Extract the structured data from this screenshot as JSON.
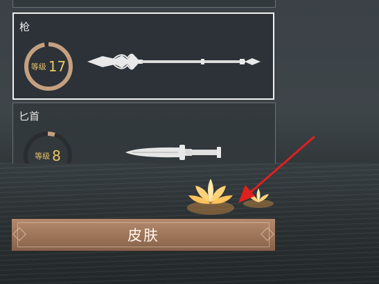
{
  "weapons": [
    {
      "name": "枪",
      "level_label": "等级",
      "level": "17",
      "progress": 0.97,
      "selected": true
    },
    {
      "name": "匕首",
      "level_label": "等级",
      "level": "8",
      "progress": 0.05,
      "selected": false
    }
  ],
  "skin_button": {
    "label": "皮肤"
  },
  "colors": {
    "accent_gold": "#ecc863",
    "button": "#a07a5e",
    "selected_border": "#f2f2f2",
    "arrow": "#e02020"
  }
}
